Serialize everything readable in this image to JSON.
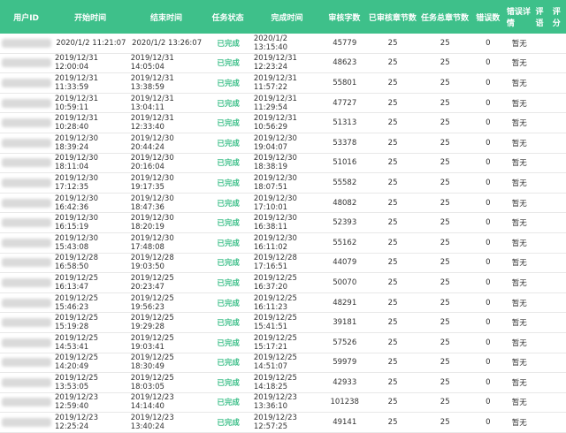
{
  "table": {
    "headers": [
      "用户ID",
      "开始时间",
      "结束时间",
      "任务状态",
      "完成时间",
      "审核字数",
      "已审核章节数",
      "任务总章节数",
      "错误数",
      "错误详情",
      "评语",
      "评分"
    ],
    "rows": [
      {
        "start": "2020/1/2 11:21:07",
        "end": "2020/1/2 13:26:07",
        "status": "已完成",
        "done": "2020/1/2 13:15:40",
        "words": "45779",
        "reviewed": "25",
        "total": "25",
        "errors": "0",
        "detail": "暂无"
      },
      {
        "start": "2019/12/31 12:00:04",
        "end": "2019/12/31 14:05:04",
        "status": "已完成",
        "done": "2019/12/31 12:23:24",
        "words": "48623",
        "reviewed": "25",
        "total": "25",
        "errors": "0",
        "detail": "暂无"
      },
      {
        "start": "2019/12/31 11:33:59",
        "end": "2019/12/31 13:38:59",
        "status": "已完成",
        "done": "2019/12/31 11:57:22",
        "words": "55801",
        "reviewed": "25",
        "total": "25",
        "errors": "0",
        "detail": "暂无"
      },
      {
        "start": "2019/12/31 10:59:11",
        "end": "2019/12/31 13:04:11",
        "status": "已完成",
        "done": "2019/12/31 11:29:54",
        "words": "47727",
        "reviewed": "25",
        "total": "25",
        "errors": "0",
        "detail": "暂无"
      },
      {
        "start": "2019/12/31 10:28:40",
        "end": "2019/12/31 12:33:40",
        "status": "已完成",
        "done": "2019/12/31 10:56:29",
        "words": "51313",
        "reviewed": "25",
        "total": "25",
        "errors": "0",
        "detail": "暂无"
      },
      {
        "start": "2019/12/30 18:39:24",
        "end": "2019/12/30 20:44:24",
        "status": "已完成",
        "done": "2019/12/30 19:04:07",
        "words": "53378",
        "reviewed": "25",
        "total": "25",
        "errors": "0",
        "detail": "暂无"
      },
      {
        "start": "2019/12/30 18:11:04",
        "end": "2019/12/30 20:16:04",
        "status": "已完成",
        "done": "2019/12/30 18:38:19",
        "words": "51016",
        "reviewed": "25",
        "total": "25",
        "errors": "0",
        "detail": "暂无"
      },
      {
        "start": "2019/12/30 17:12:35",
        "end": "2019/12/30 19:17:35",
        "status": "已完成",
        "done": "2019/12/30 18:07:51",
        "words": "55582",
        "reviewed": "25",
        "total": "25",
        "errors": "0",
        "detail": "暂无"
      },
      {
        "start": "2019/12/30 16:42:36",
        "end": "2019/12/30 18:47:36",
        "status": "已完成",
        "done": "2019/12/30 17:10:01",
        "words": "48082",
        "reviewed": "25",
        "total": "25",
        "errors": "0",
        "detail": "暂无"
      },
      {
        "start": "2019/12/30 16:15:19",
        "end": "2019/12/30 18:20:19",
        "status": "已完成",
        "done": "2019/12/30 16:38:11",
        "words": "52393",
        "reviewed": "25",
        "total": "25",
        "errors": "0",
        "detail": "暂无"
      },
      {
        "start": "2019/12/30 15:43:08",
        "end": "2019/12/30 17:48:08",
        "status": "已完成",
        "done": "2019/12/30 16:11:02",
        "words": "55162",
        "reviewed": "25",
        "total": "25",
        "errors": "0",
        "detail": "暂无"
      },
      {
        "start": "2019/12/28 16:58:50",
        "end": "2019/12/28 19:03:50",
        "status": "已完成",
        "done": "2019/12/28 17:16:51",
        "words": "44079",
        "reviewed": "25",
        "total": "25",
        "errors": "0",
        "detail": "暂无"
      },
      {
        "start": "2019/12/25 16:13:47",
        "end": "2019/12/25 20:23:47",
        "status": "已完成",
        "done": "2019/12/25 16:37:20",
        "words": "50070",
        "reviewed": "25",
        "total": "25",
        "errors": "0",
        "detail": "暂无"
      },
      {
        "start": "2019/12/25 15:46:23",
        "end": "2019/12/25 19:56:23",
        "status": "已完成",
        "done": "2019/12/25 16:11:23",
        "words": "48291",
        "reviewed": "25",
        "total": "25",
        "errors": "0",
        "detail": "暂无"
      },
      {
        "start": "2019/12/25 15:19:28",
        "end": "2019/12/25 19:29:28",
        "status": "已完成",
        "done": "2019/12/25 15:41:51",
        "words": "39181",
        "reviewed": "25",
        "total": "25",
        "errors": "0",
        "detail": "暂无"
      },
      {
        "start": "2019/12/25 14:53:41",
        "end": "2019/12/25 19:03:41",
        "status": "已完成",
        "done": "2019/12/25 15:17:21",
        "words": "57526",
        "reviewed": "25",
        "total": "25",
        "errors": "0",
        "detail": "暂无"
      },
      {
        "start": "2019/12/25 14:20:49",
        "end": "2019/12/25 18:30:49",
        "status": "已完成",
        "done": "2019/12/25 14:51:07",
        "words": "59979",
        "reviewed": "25",
        "total": "25",
        "errors": "0",
        "detail": "暂无"
      },
      {
        "start": "2019/12/25 13:53:05",
        "end": "2019/12/25 18:03:05",
        "status": "已完成",
        "done": "2019/12/25 14:18:25",
        "words": "42933",
        "reviewed": "25",
        "total": "25",
        "errors": "0",
        "detail": "暂无"
      },
      {
        "start": "2019/12/23 12:59:40",
        "end": "2019/12/23 14:14:40",
        "status": "已完成",
        "done": "2019/12/23 13:36:10",
        "words": "101238",
        "reviewed": "25",
        "total": "25",
        "errors": "0",
        "detail": "暂无"
      },
      {
        "start": "2019/12/23 12:25:24",
        "end": "2019/12/23 13:40:24",
        "status": "已完成",
        "done": "2019/12/23 12:57:25",
        "words": "49141",
        "reviewed": "25",
        "total": "25",
        "errors": "0",
        "detail": "暂无"
      }
    ]
  }
}
